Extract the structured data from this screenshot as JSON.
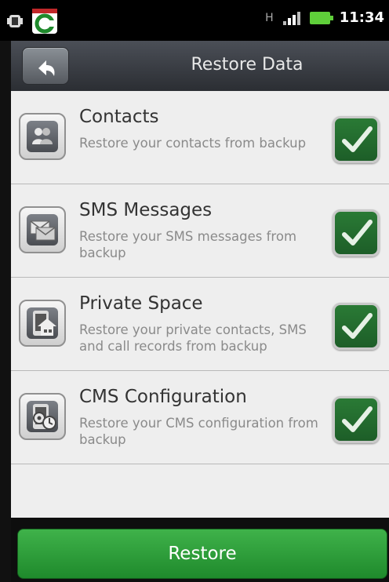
{
  "status_bar": {
    "time": "11:34",
    "network_type": "H",
    "icons": [
      "android-debug-icon",
      "comodo-app-icon",
      "network-h-icon",
      "signal-icon",
      "battery-icon"
    ]
  },
  "header": {
    "title": "Restore Data",
    "back_icon": "back-arrow-icon"
  },
  "items": [
    {
      "name": "Contacts",
      "description": "Restore your contacts from backup",
      "icon": "contacts-icon",
      "checked": true
    },
    {
      "name": "SMS Messages",
      "description": "Restore your SMS messages from backup",
      "icon": "sms-icon",
      "checked": true
    },
    {
      "name": "Private Space",
      "description": "Restore your private contacts, SMS and call records from backup",
      "icon": "private-space-icon",
      "checked": true
    },
    {
      "name": "CMS Configuration",
      "description": "Restore your CMS configuration from backup",
      "icon": "cms-configuration-icon",
      "checked": true
    }
  ],
  "footer": {
    "restore_label": "Restore"
  },
  "colors": {
    "accent_green": "#2e9e3a",
    "title_bar": "#3a3d42",
    "list_background": "#eeeeee"
  }
}
